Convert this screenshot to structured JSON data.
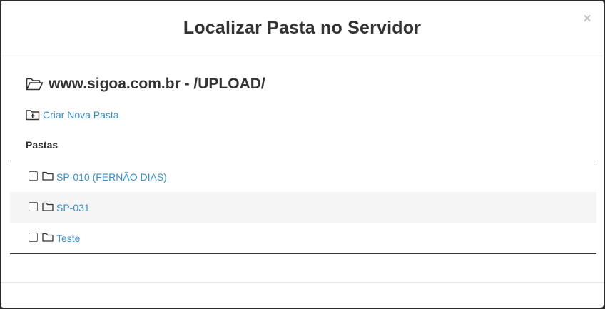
{
  "modal": {
    "title": "Localizar Pasta no Servidor",
    "close_label": "×"
  },
  "body": {
    "path": "www.sigoa.com.br - /UPLOAD/",
    "new_folder_label": "Criar Nova Pasta",
    "section_label": "Pastas",
    "folders": [
      {
        "name": "SP-010 (FERNÃO DIAS)"
      },
      {
        "name": "SP-031"
      },
      {
        "name": "Teste"
      }
    ]
  },
  "colors": {
    "link": "#3a8fc4",
    "text": "#333333",
    "stripe": "#f5f5f5"
  }
}
